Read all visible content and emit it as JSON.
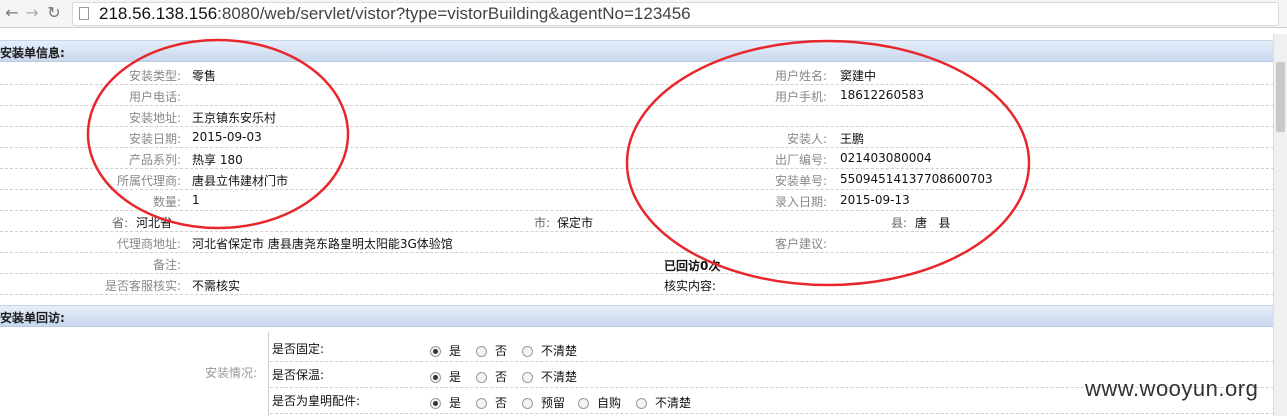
{
  "browser": {
    "url_host": "218.56.138.156",
    "url_rest": ":8080/web/servlet/vistor?type=vistorBuilding&agentNo=123456"
  },
  "section1": {
    "title": "安装单信息:"
  },
  "section2": {
    "title": "安装单回访:"
  },
  "left_fields": [
    {
      "label": "安装类型:",
      "value": "零售"
    },
    {
      "label": "用户电话:",
      "value": ""
    },
    {
      "label": "安装地址:",
      "value": "王京镇东安乐村"
    },
    {
      "label": "安装日期:",
      "value": "2015-09-03"
    },
    {
      "label": "产品系列:",
      "value": "热享 180"
    },
    {
      "label": "所属代理商:",
      "value": "唐县立伟建材门市"
    },
    {
      "label": "数量:",
      "value": "1"
    }
  ],
  "right_fields": [
    {
      "label": "用户姓名:",
      "value": "窦建中"
    },
    {
      "label": "用户手机:",
      "value": "18612260583"
    },
    {
      "label": "",
      "value": ""
    },
    {
      "label": "安装人:",
      "value": "王鹏"
    },
    {
      "label": "出厂编号:",
      "value": "021403080004"
    },
    {
      "label": "安装单号:",
      "value": "55094514137708600703"
    },
    {
      "label": "录入日期:",
      "value": "2015-09-13"
    }
  ],
  "region": {
    "province_label": "省:",
    "province_value": "河北省",
    "city_label": "市:",
    "city_value": "保定市",
    "county_label": "县:",
    "county_value": "唐   县"
  },
  "agent_address": {
    "label": "代理商地址:",
    "value": "河北省保定市 唐县唐尧东路皇明太阳能3G体验馆"
  },
  "customer_advice": {
    "label": "客户建议:",
    "value": ""
  },
  "remark": {
    "label": "备注:",
    "value": ""
  },
  "revisit_count": "已回访0次",
  "verify": {
    "label": "是否客服核实:",
    "value": "不需核实"
  },
  "verify_content": {
    "label": "核实内容:",
    "value": ""
  },
  "install_situation_label": "安装情况:",
  "questions": [
    {
      "label": "是否固定:",
      "options": [
        "是",
        "否",
        "不清楚"
      ],
      "selected": 0
    },
    {
      "label": "是否保温:",
      "options": [
        "是",
        "否",
        "不清楚"
      ],
      "selected": 0
    },
    {
      "label": "是否为皇明配件:",
      "options": [
        "是",
        "否",
        "预留",
        "自购",
        "不清楚"
      ],
      "selected": 0
    }
  ],
  "watermark": "www.wooyun.org",
  "annotation_color": "#e8272c"
}
